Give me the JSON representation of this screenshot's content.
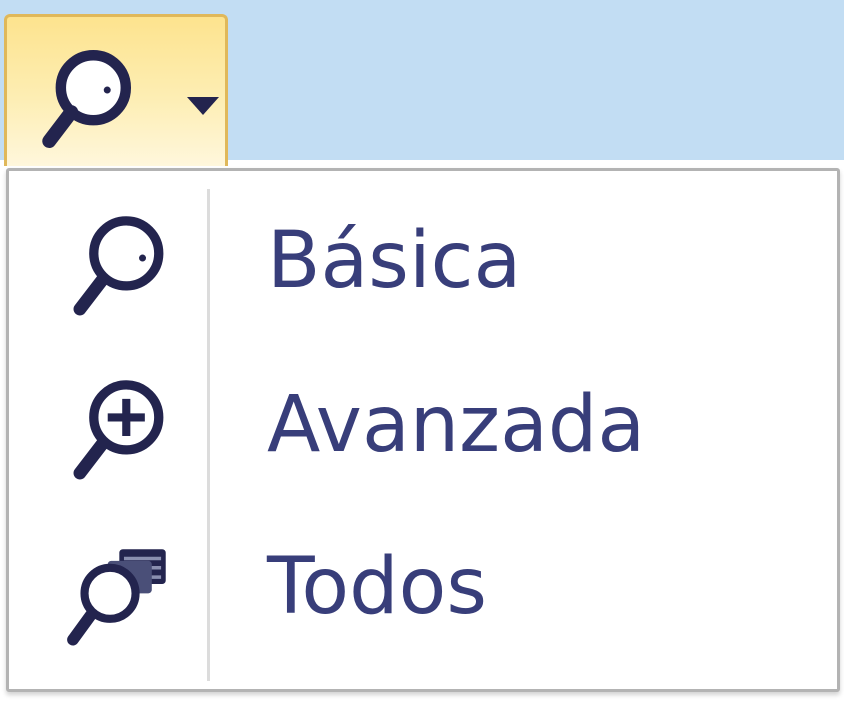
{
  "split_button": {
    "icon": "search-icon",
    "arrow_icon": "chevron-down-icon"
  },
  "menu": {
    "items": [
      {
        "label": "Básica",
        "icon": "search-icon"
      },
      {
        "label": "Avanzada",
        "icon": "search-plus-icon"
      },
      {
        "label": "Todos",
        "icon": "search-all-icon"
      }
    ]
  },
  "colors": {
    "toolbar_background": "#c2ddf3",
    "button_hover": "#fde38e",
    "button_border": "#e0b85a",
    "menu_text": "#383e7a",
    "icon_color": "#23244e"
  }
}
